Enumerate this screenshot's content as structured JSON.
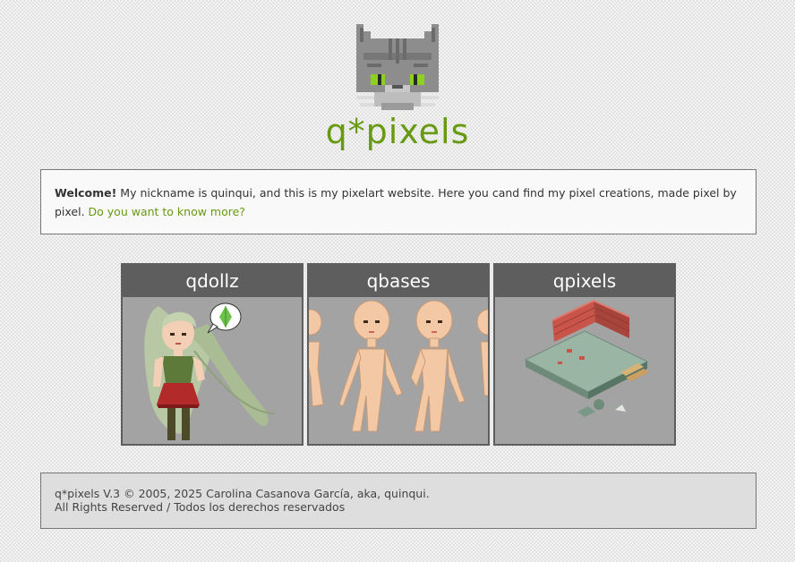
{
  "site": {
    "title": "q*pixels"
  },
  "logo": {
    "icon": "pixel-cat-icon"
  },
  "welcome": {
    "bold": "Welcome!",
    "text": " My nickname is quinqui, and this is my pixelart website. Here you cand find my pixel creations, made pixel by pixel. ",
    "link": "Do you want to know more?"
  },
  "cards": [
    {
      "title": "qdollz",
      "icon": "pixel-doll-icon"
    },
    {
      "title": "qbases",
      "icon": "doll-bases-icon"
    },
    {
      "title": "qpixels",
      "icon": "pixel-room-icon"
    }
  ],
  "footer": {
    "line1": "q*pixels V.3 © 2005, 2025 Carolina Casanova García, aka, quinqui.",
    "line2": "All Rights Reserved / Todos los derechos reservados"
  },
  "colors": {
    "accent": "#679a10",
    "card_header": "#5e5e5e",
    "card_bg": "#a3a3a3"
  }
}
